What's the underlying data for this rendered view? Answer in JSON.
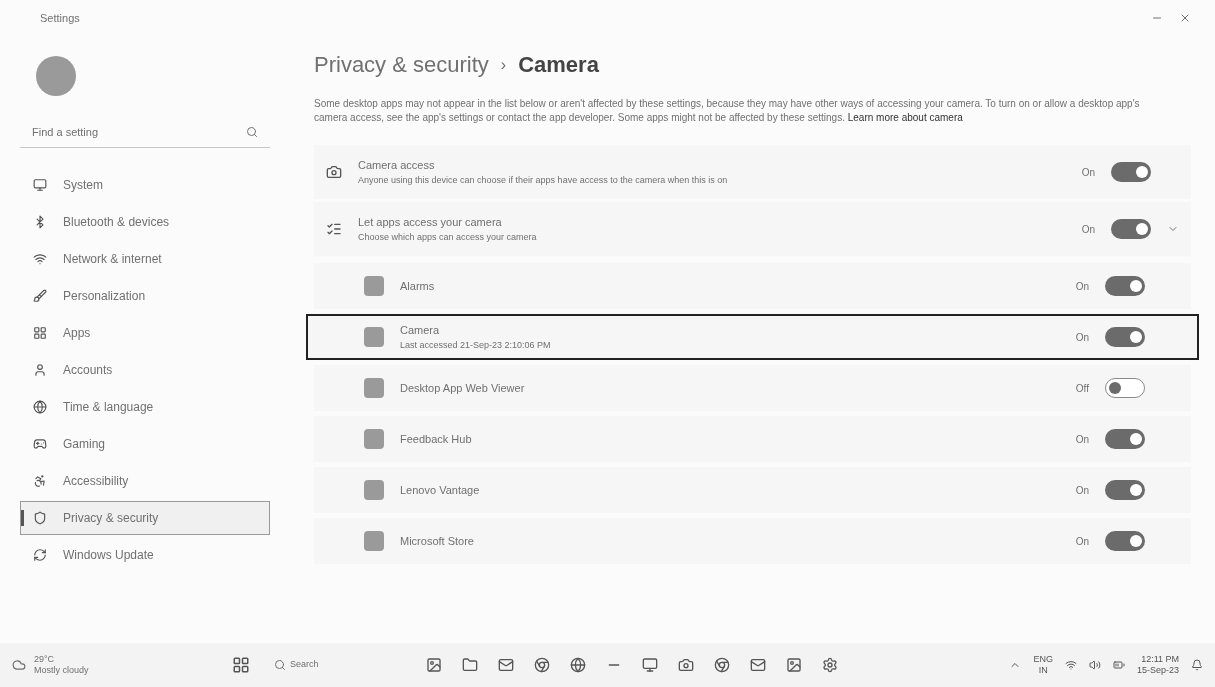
{
  "window": {
    "title": "Settings"
  },
  "sidebar": {
    "search": {
      "placeholder": "Find a setting"
    },
    "items": [
      {
        "label": "System",
        "selected": false
      },
      {
        "label": "Bluetooth & devices",
        "selected": false
      },
      {
        "label": "Network & internet",
        "selected": false
      },
      {
        "label": "Personalization",
        "selected": false
      },
      {
        "label": "Apps",
        "selected": false
      },
      {
        "label": "Accounts",
        "selected": false
      },
      {
        "label": "Time & language",
        "selected": false
      },
      {
        "label": "Gaming",
        "selected": false
      },
      {
        "label": "Accessibility",
        "selected": false
      },
      {
        "label": "Privacy & security",
        "selected": true
      },
      {
        "label": "Windows Update",
        "selected": false
      }
    ]
  },
  "breadcrumb": {
    "parent": "Privacy & security",
    "separator": "›",
    "current": "Camera"
  },
  "description": {
    "text": "Some desktop apps may not appear in the list below or aren't affected by these settings, because they may have other ways of accessing your camera. To turn on or allow a desktop app's camera access, see the app's settings or contact the app developer. Some apps",
    "text2": "might not be affected by these settings.",
    "link": "Learn more about camera"
  },
  "settings": [
    {
      "title": "Camera access",
      "subtitle": "Anyone using this device can choose if their apps have access to the camera when this is on",
      "state": "On",
      "on": true,
      "expandable": false
    },
    {
      "title": "Let apps access your camera",
      "subtitle": "Choose which apps can access your camera",
      "state": "On",
      "on": true,
      "expandable": true
    }
  ],
  "apps": [
    {
      "name": "Alarms",
      "state": "On",
      "on": true,
      "highlighted": false
    },
    {
      "name": "Camera",
      "detail": "Last accessed 21-Sep-23 2:10:06 PM",
      "state": "On",
      "on": true,
      "highlighted": true
    },
    {
      "name": "Desktop App Web Viewer",
      "state": "Off",
      "on": false,
      "highlighted": false
    },
    {
      "name": "Feedback Hub",
      "state": "On",
      "on": true,
      "highlighted": false
    },
    {
      "name": "Lenovo Vantage",
      "state": "On",
      "on": true,
      "highlighted": false
    },
    {
      "name": "Microsoft Store",
      "state": "On",
      "on": true,
      "highlighted": false
    }
  ],
  "taskbar": {
    "weather": {
      "temp": "29°C",
      "condition": "Mostly cloudy"
    },
    "search": "Search",
    "tray": {
      "lang": "ENG",
      "region": "IN",
      "time": "12:11 PM",
      "date": "15-Sep-23"
    }
  }
}
